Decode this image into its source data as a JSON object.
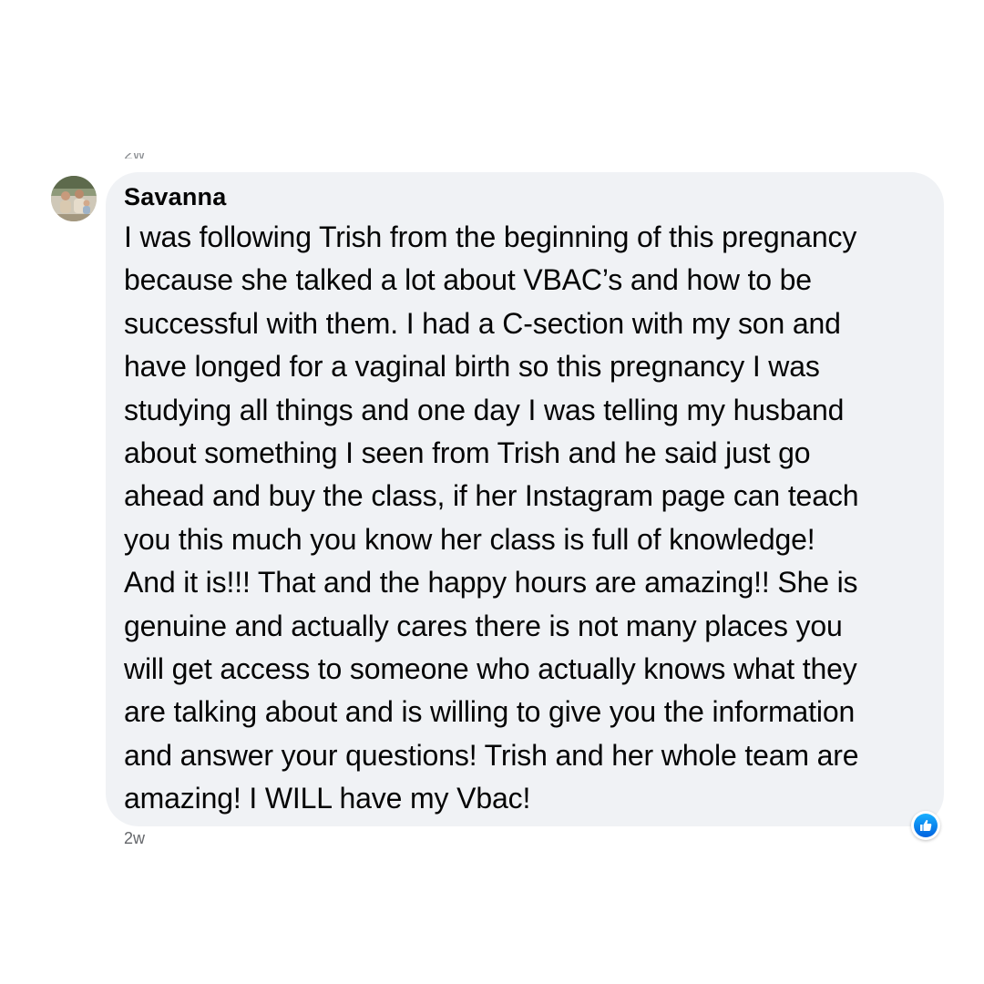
{
  "previous_comment": {
    "timestamp_fragment": "2w"
  },
  "comment": {
    "author": "Savanna",
    "avatar_icon": "user-avatar-photo",
    "lines": [
      "I was following Trish from the beginning of this pregnancy",
      "because she talked a lot about VBAC’s and how to be",
      "successful with them. I had a C-section with my son and",
      "have longed for a vaginal birth so this pregnancy I was",
      "studying all things and one day I was telling my husband",
      "about something I seen from Trish and he said just go",
      "ahead and buy the class, if her Instagram page can teach",
      "you this much you know her class is full of knowledge!",
      "And it is!!! That and the happy hours are amazing!! She is",
      "genuine and actually cares there is not many places you",
      "will get access to someone who actually knows what they",
      "are talking about and is willing to give you the information",
      "and answer your questions! Trish and her whole team are",
      "amazing! I WILL have my Vbac!"
    ],
    "timestamp": "2w",
    "reaction_icon": "like-reaction-icon"
  },
  "colors": {
    "bubble_background": "#f0f2f5",
    "text": "#050505",
    "meta_text": "#65676b",
    "like_blue": "#0866ff"
  }
}
